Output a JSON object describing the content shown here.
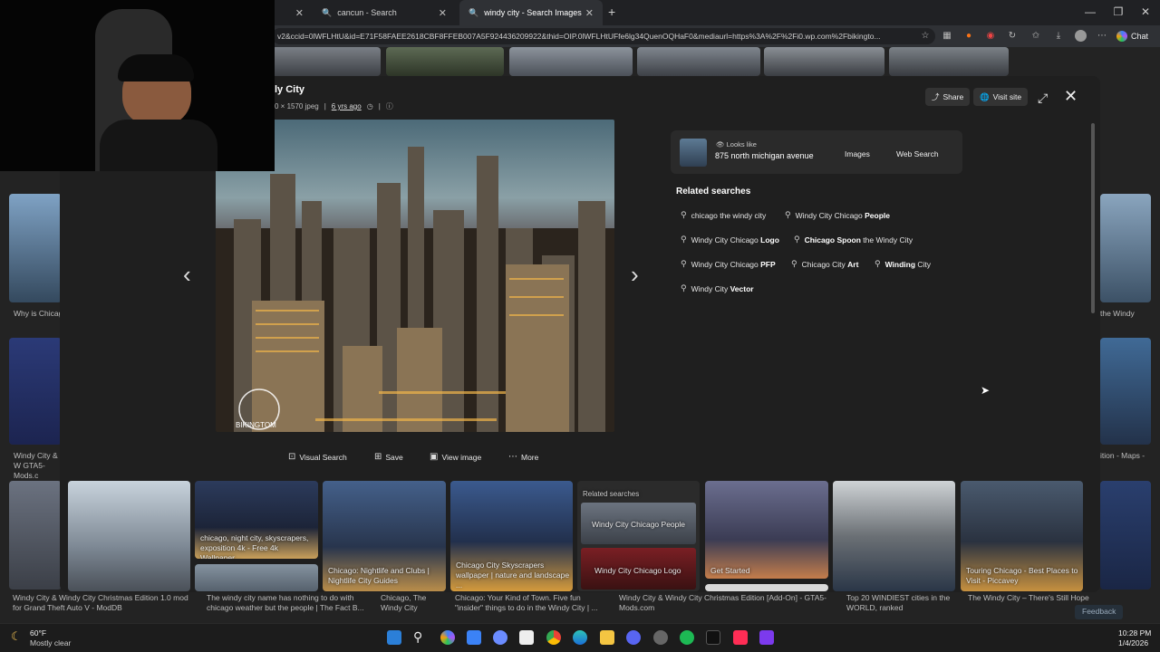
{
  "browser": {
    "tabs": [
      {
        "label": "",
        "active": false
      },
      {
        "label": "cancun - Search",
        "active": false
      },
      {
        "label": "windy city - Search Images",
        "active": true
      }
    ],
    "url": "v2&ccid=0lWFLHtU&id=E71F58FAEE2618CBF8FFEB007A5F924436209922&thid=OIP.0lWFLHtUFfe6lg34QuenOQHaF0&mediaurl=https%3A%2F%2Fi0.wp.com%2Fbikingto...",
    "chat_label": "Chat"
  },
  "modal": {
    "title": "ly City",
    "dimensions": "0 × 1570 jpeg",
    "age": "6 yrs ago",
    "share_label": "Share",
    "visit_label": "Visit site",
    "image_watermark": "BIKINGTOM",
    "actions": {
      "visual_search": "Visual Search",
      "save": "Save",
      "view_image": "View image",
      "more": "More"
    },
    "looks_like": {
      "label": "Looks like",
      "name": "875 north michigan avenue",
      "images": "Images",
      "web_search": "Web Search"
    },
    "related_heading": "Related searches",
    "chips": [
      {
        "plain": "chicago the windy city",
        "bold": ""
      },
      {
        "plain": "Windy City Chicago ",
        "bold": "People"
      },
      {
        "plain": "Windy City Chicago ",
        "bold": "Logo"
      },
      {
        "plain": "the Windy City",
        "bold": "Chicago Spoon "
      },
      {
        "plain": "Windy City Chicago ",
        "bold": "PFP"
      },
      {
        "plain": "Chicago City ",
        "bold": "Art"
      },
      {
        "plain": " City",
        "bold": "Winding"
      },
      {
        "plain": "Windy City ",
        "bold": "Vector"
      }
    ]
  },
  "strip": {
    "captions": [
      "",
      "chicago, night city, skyscrapers, exposition 4k - Free 4k Wallpaper...",
      "Chicago: Nightlife and Clubs | Nightlife City Guides",
      "Chicago City Skyscrapers wallpaper | nature and landscape ...",
      "Related searches",
      "Windy City Chicago People",
      "Windy City Chicago Logo",
      "Get Started",
      "",
      "Touring Chicago - Best Places to Visit - Piccavey"
    ]
  },
  "background": {
    "left_captions": [
      "Why is Chicag",
      "Windy City & W GTA5-Mods.c"
    ],
    "right_captions": [
      "the Windy",
      "ition - Maps -"
    ],
    "bottom_captions": [
      "Windy City & Windy City Christmas Edition 1.0 mod for Grand Theft Auto V - ModDB",
      "The windy city name has nothing to do with chicago weather but the people | The Fact B...",
      "Chicago, The Windy City",
      "Chicago: Your Kind of Town. Five fun \"insider\" things to do in the Windy City | ...",
      "Windy City & Windy City Christmas Edition [Add-On] - GTA5-Mods.com",
      "Top 20 WINDIEST cities in the WORLD, ranked",
      "The Windy City – There's Still Hope"
    ],
    "feedback": "Feedback"
  },
  "taskbar": {
    "temperature": "60°F",
    "weather": "Mostly clear",
    "time": "10:28 PM",
    "date": "1/4/2026"
  }
}
